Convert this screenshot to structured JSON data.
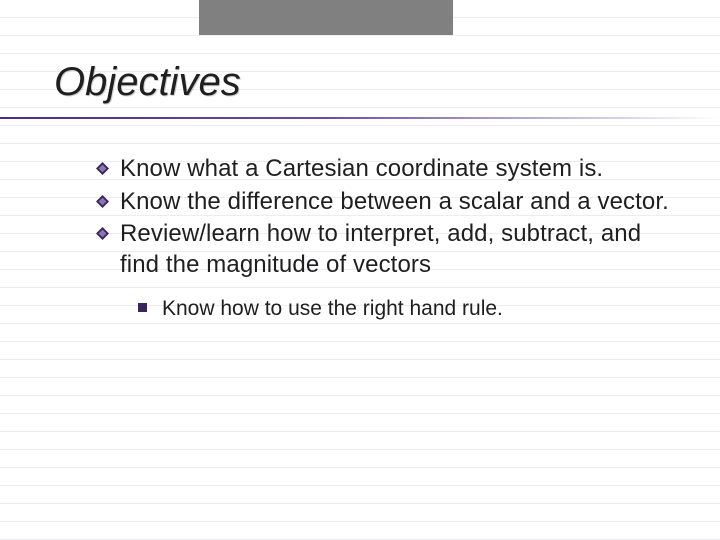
{
  "title": "Objectives",
  "bullets": {
    "b0": "Know what a Cartesian coordinate system is.",
    "b1": "Know the difference between a scalar and a vector.",
    "b2": "Review/learn how to interpret, add, subtract, and find the magnitude of vectors"
  },
  "sub": {
    "s0": "Know how to use the right hand rule."
  },
  "colors": {
    "accent": "#4b2e83",
    "bullet_fill": "#37265a"
  }
}
